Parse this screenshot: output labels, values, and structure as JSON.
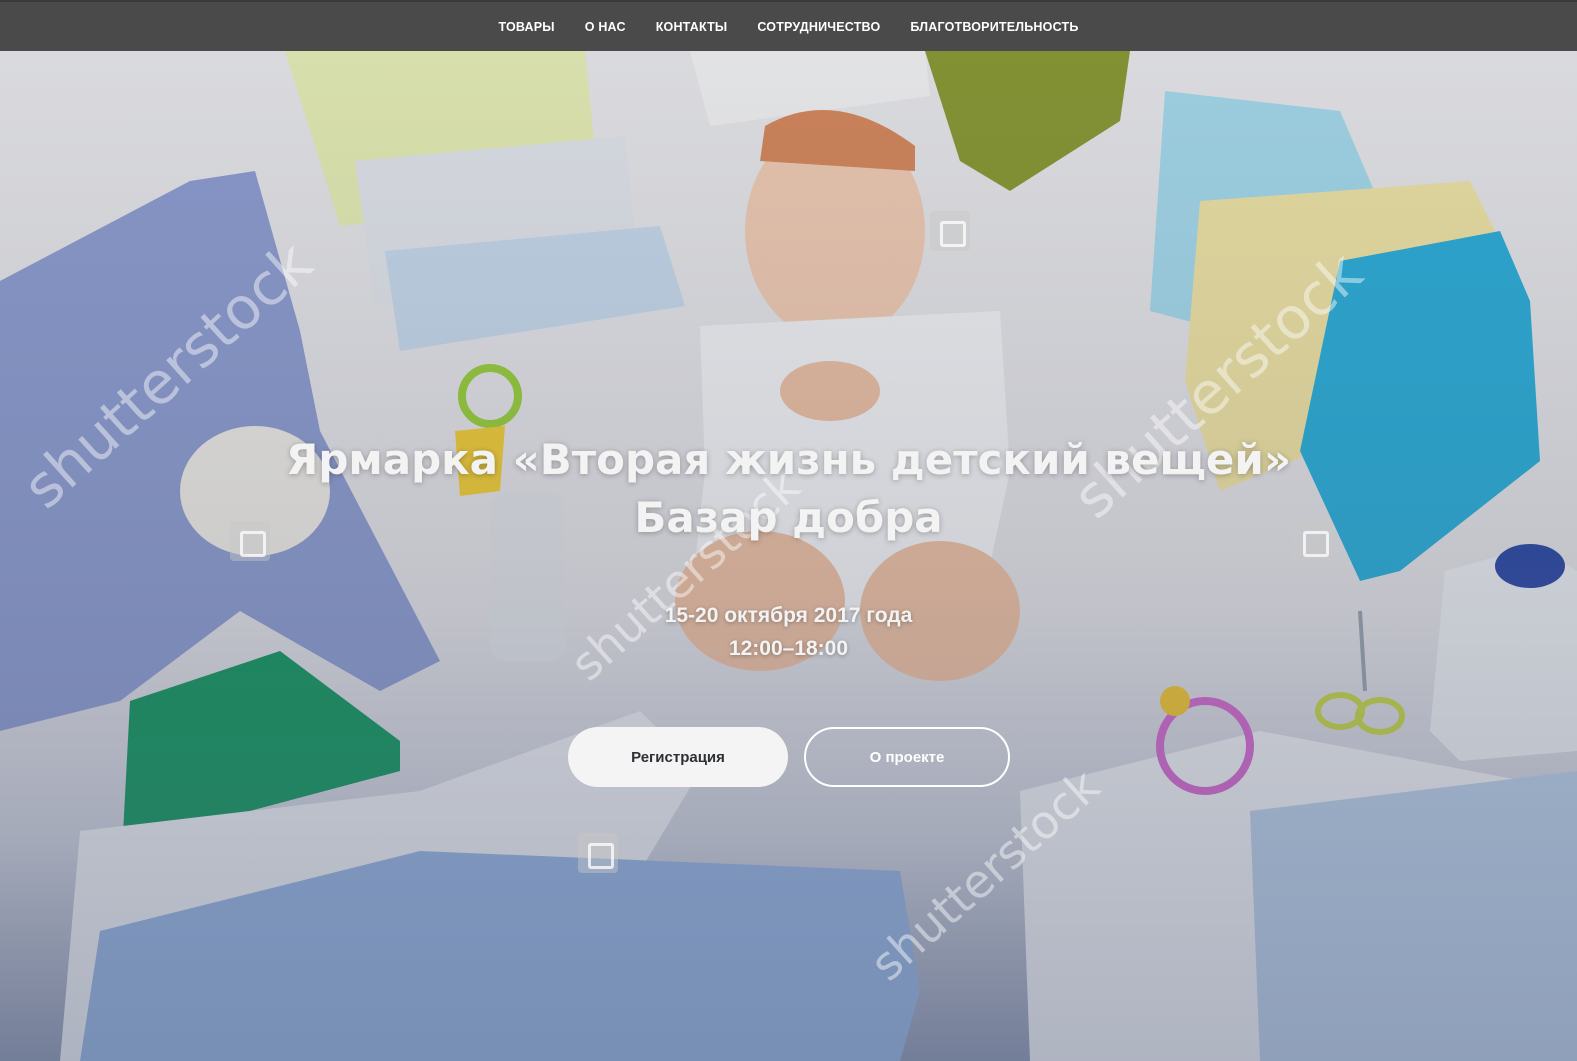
{
  "nav": {
    "items": [
      {
        "label": "ТОВАРЫ"
      },
      {
        "label": "О НАС"
      },
      {
        "label": "КОНТАКТЫ"
      },
      {
        "label": "СОТРУДНИЧЕСТВО"
      },
      {
        "label": "БЛАГОТВОРИТЕЛЬНОСТЬ"
      }
    ]
  },
  "hero": {
    "title_line1": "Ярмарка «Вторая жизнь детский вещей»",
    "title_line2": "Базар добра",
    "date_line1": "15-20 октября 2017 года",
    "date_line2": "12:00–18:00",
    "watermark": "shutterstock"
  },
  "buttons": {
    "register_label": "Регистрация",
    "about_label": "О проекте"
  },
  "colors": {
    "navbar": "#4a4a4a",
    "button_primary_bg": "#f4f4f4",
    "button_text": "#2d2f36"
  }
}
